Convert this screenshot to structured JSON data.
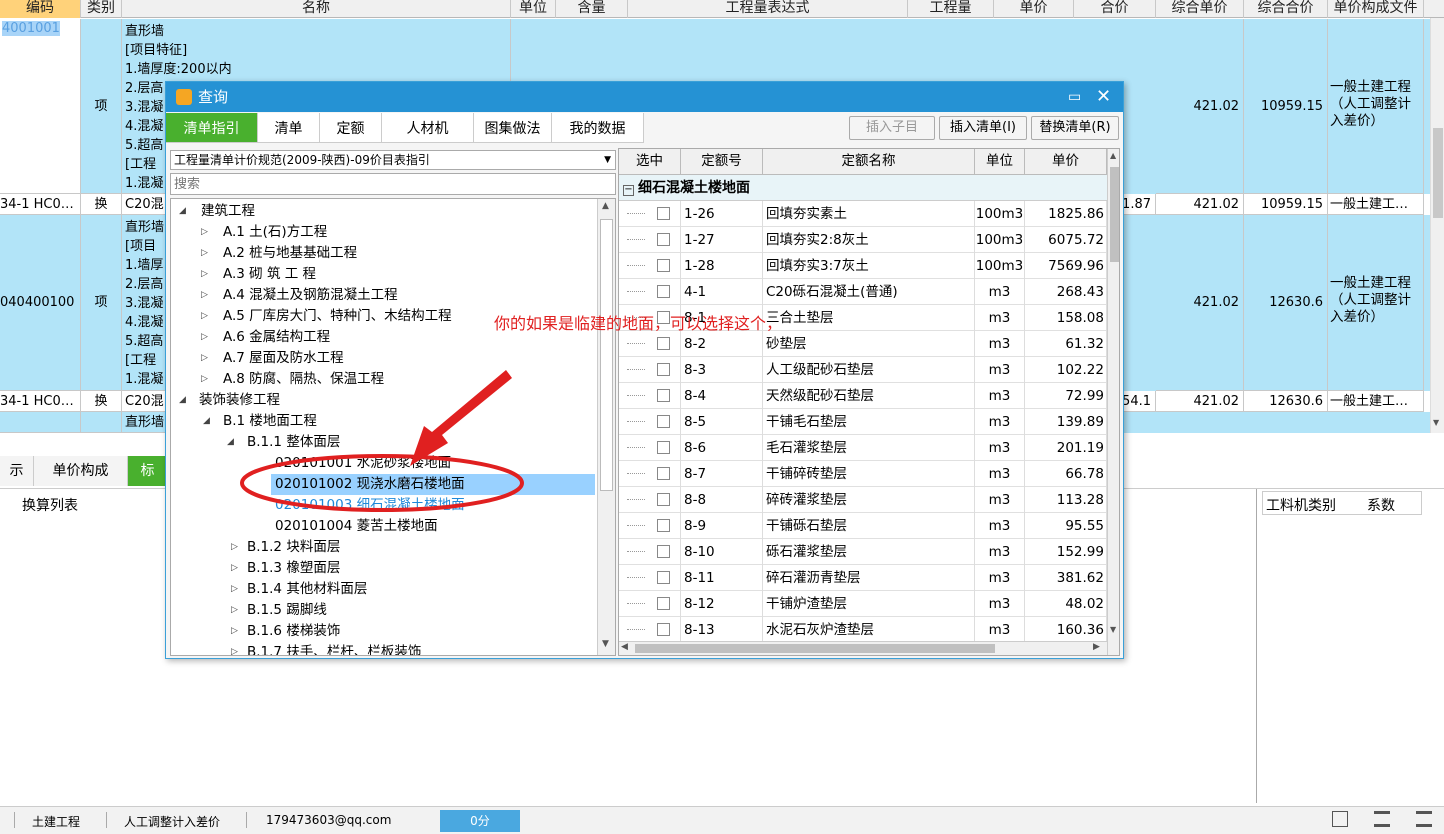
{
  "grid": {
    "headers": [
      "编码",
      "类别",
      "名称",
      "单位",
      "含量",
      "工程量表达式",
      "工程量",
      "单价",
      "合价",
      "综合单价",
      "综合合价",
      "单价构成文件"
    ],
    "rows": [
      {
        "code": "4001001",
        "type": "项",
        "name_lines": [
          "直形墙",
          "[项目特征]",
          "1.墙厚度:200以内",
          "2.层高",
          "3.混凝",
          "4.混凝",
          "5.超高",
          "[工程",
          "1.混凝"
        ],
        "zhdj": "421.02",
        "zhhj": "10959.15",
        "file": "一般土建工程（人工调整计入差价）"
      },
      {
        "code": "34-1 HC0…",
        "type": "换",
        "name": "C20混",
        "hj": "1.87",
        "zhdj": "421.02",
        "zhhj": "10959.15",
        "file": "一般土建工…"
      },
      {
        "code": "040400100",
        "type": "项",
        "name_lines": [
          "直形墙",
          "[项目",
          "1.墙厚",
          "2.层高",
          "3.混凝",
          "4.混凝",
          "5.超高",
          "[工程",
          "1.混凝"
        ],
        "zhdj": "421.02",
        "zhhj": "12630.6",
        "file": "一般土建工程（人工调整计入差价）"
      },
      {
        "code": "34-1 HC0…",
        "type": "换",
        "name": "C20混",
        "hj": "54.1",
        "zhdj": "421.02",
        "zhhj": "12630.6",
        "file": "一般土建工…"
      },
      {
        "code": "",
        "type": "",
        "name": "直形墙"
      }
    ]
  },
  "bottom_tabs": [
    "示",
    "单价构成",
    "标"
  ],
  "lower_panel": {
    "left_header": "换算列表",
    "right_headers": [
      "工料机类别",
      "系数"
    ]
  },
  "status": {
    "items": [
      "土建工程",
      "人工调整计入差价",
      "179473603@qq.com"
    ],
    "badge": "0分"
  },
  "dialog": {
    "title": "查询",
    "tabs": [
      "清单指引",
      "清单",
      "定额",
      "人材机",
      "图集做法",
      "我的数据"
    ],
    "buttons": [
      "插入子目",
      "插入清单(I)",
      "替换清单(R)"
    ],
    "spec_select": "工程量清单计价规范(2009-陕西)-09价目表指引",
    "search_placeholder": "搜索",
    "tree": [
      {
        "label": "建筑工程",
        "level": 0,
        "expanded": true
      },
      {
        "label": "A.1   土(石)方工程",
        "level": 1
      },
      {
        "label": "A.2   桩与地基基础工程",
        "level": 1
      },
      {
        "label": "A.3   砌 筑 工 程",
        "level": 1
      },
      {
        "label": "A.4   混凝土及钢筋混凝土工程",
        "level": 1
      },
      {
        "label": "A.5   厂库房大门、特种门、木结构工程",
        "level": 1
      },
      {
        "label": "A.6   金属结构工程",
        "level": 1
      },
      {
        "label": "A.7   屋面及防水工程",
        "level": 1
      },
      {
        "label": "A.8   防腐、隔热、保温工程",
        "level": 1
      },
      {
        "label": "装饰装修工程",
        "level": 0,
        "expanded": true
      },
      {
        "label": "B.1   楼地面工程",
        "level": 1,
        "expanded": true
      },
      {
        "label": "B.1.1   整体面层",
        "level": 2,
        "expanded": true
      },
      {
        "label": "020101001   水泥砂浆楼地面",
        "level": 3
      },
      {
        "label": "020101002   现浇水磨石楼地面",
        "level": 3,
        "selected": true
      },
      {
        "label": "020101003   细石混凝土楼地面",
        "level": 3,
        "link": true
      },
      {
        "label": "020101004   菱苦土楼地面",
        "level": 3
      },
      {
        "label": "B.1.2   块料面层",
        "level": 2
      },
      {
        "label": "B.1.3   橡塑面层",
        "level": 2
      },
      {
        "label": "B.1.4   其他材料面层",
        "level": 2
      },
      {
        "label": "B.1.5   踢脚线",
        "level": 2
      },
      {
        "label": "B.1.6   楼梯装饰",
        "level": 2
      },
      {
        "label": "B.1.7   扶手、栏杆、栏板装饰",
        "level": 2
      }
    ],
    "quota_headers": [
      "选中",
      "定额号",
      "定额名称",
      "单位",
      "单价"
    ],
    "group_title": "细石混凝土楼地面",
    "quota_rows": [
      {
        "code": "1-26",
        "name": "回填夯实素土",
        "unit": "100m3",
        "price": "1825.86"
      },
      {
        "code": "1-27",
        "name": "回填夯实2:8灰土",
        "unit": "100m3",
        "price": "6075.72"
      },
      {
        "code": "1-28",
        "name": "回填夯实3:7灰土",
        "unit": "100m3",
        "price": "7569.96"
      },
      {
        "code": "4-1",
        "name": "C20砾石混凝土(普通)",
        "unit": "m3",
        "price": "268.43"
      },
      {
        "code": "8-1",
        "name": "三合土垫层",
        "unit": "m3",
        "price": "158.08"
      },
      {
        "code": "8-2",
        "name": "砂垫层",
        "unit": "m3",
        "price": "61.32"
      },
      {
        "code": "8-3",
        "name": "人工级配砂石垫层",
        "unit": "m3",
        "price": "102.22"
      },
      {
        "code": "8-4",
        "name": "天然级配砂石垫层",
        "unit": "m3",
        "price": "72.99"
      },
      {
        "code": "8-5",
        "name": "干铺毛石垫层",
        "unit": "m3",
        "price": "139.89"
      },
      {
        "code": "8-6",
        "name": "毛石灌浆垫层",
        "unit": "m3",
        "price": "201.19"
      },
      {
        "code": "8-7",
        "name": "干铺碎砖垫层",
        "unit": "m3",
        "price": "66.78"
      },
      {
        "code": "8-8",
        "name": "碎砖灌浆垫层",
        "unit": "m3",
        "price": "113.28"
      },
      {
        "code": "8-9",
        "name": "干铺砾石垫层",
        "unit": "m3",
        "price": "95.55"
      },
      {
        "code": "8-10",
        "name": "砾石灌浆垫层",
        "unit": "m3",
        "price": "152.99"
      },
      {
        "code": "8-11",
        "name": "碎石灌沥青垫层",
        "unit": "m3",
        "price": "381.62"
      },
      {
        "code": "8-12",
        "name": "干铺炉渣垫层",
        "unit": "m3",
        "price": "48.02"
      },
      {
        "code": "8-13",
        "name": "水泥石灰炉渣垫层",
        "unit": "m3",
        "price": "160.36"
      }
    ]
  },
  "annotation": "你的如果是临建的地面，可以选择这个，",
  "colors": {
    "row_blue": "#b2e4f8",
    "title_blue": "#2592d4",
    "tab_green": "#49b02e",
    "annot_red": "#e02020",
    "selected": "#99d1ff"
  }
}
